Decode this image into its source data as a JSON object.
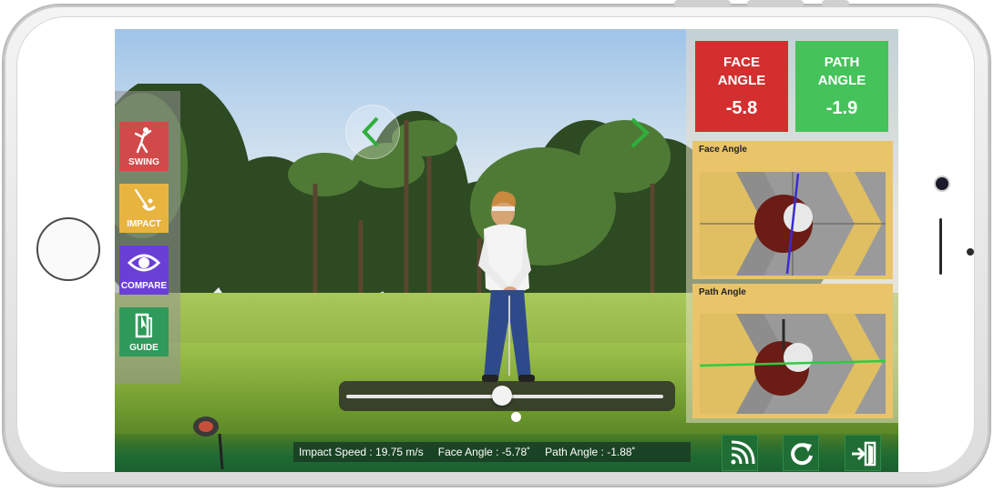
{
  "menu": {
    "swing": {
      "label": "SWING",
      "icon": "golfer-icon",
      "color": "#d04a4a"
    },
    "impact": {
      "label": "IMPACT",
      "icon": "golf-club-ball-icon",
      "color": "#e8b440"
    },
    "compare": {
      "label": "COMPARE",
      "icon": "eye-icon",
      "color": "#6a3fd6"
    },
    "guide": {
      "label": "GUIDE",
      "icon": "book-icon",
      "color": "#2f9a5a"
    }
  },
  "metrics": {
    "face": {
      "line1": "FACE",
      "line2": "ANGLE",
      "value": "-5.8",
      "color": "#d32f2f"
    },
    "path": {
      "line1": "PATH",
      "line2": "ANGLE",
      "value": "-1.9",
      "color": "#46c25a"
    }
  },
  "analysis": {
    "face_title": "Face Angle",
    "path_title": "Path Angle"
  },
  "playback": {
    "position_fraction": 0.49
  },
  "status": {
    "impact_speed": "Impact Speed : 19.75 m/s",
    "face_angle": "Face Angle : -5.78˚",
    "path_angle": "Path Angle : -1.88˚"
  },
  "buttons": {
    "sensor": "wireless-sensor-icon",
    "replay": "replay-icon",
    "exit": "exit-door-icon"
  },
  "colors": {
    "panel_gold": "#e9c46a",
    "bottom_green": "#1f6b34",
    "face_line": "#3a2bd0",
    "path_line": "#2ecc40"
  }
}
